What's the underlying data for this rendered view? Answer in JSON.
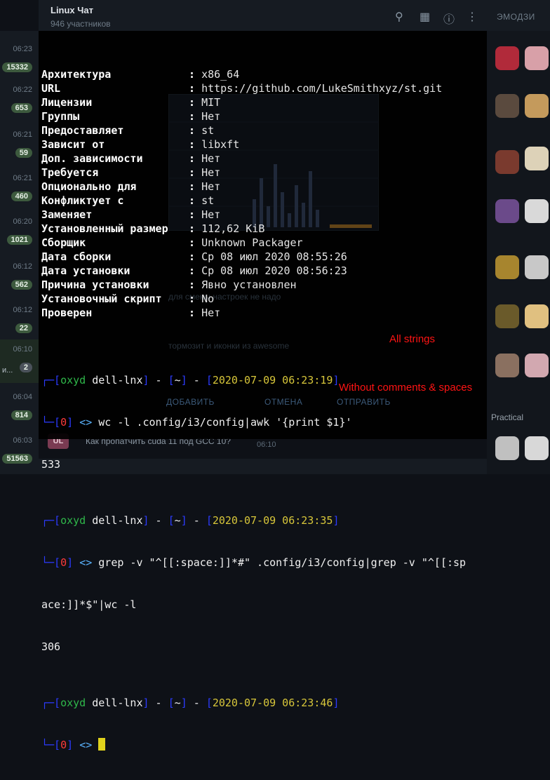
{
  "app": {
    "title": "Linux Чат",
    "subtitle": "946 участников",
    "emoji_tab": "ЭМОДЗИ"
  },
  "chats": [
    {
      "time": "06:23",
      "badge": "15332"
    },
    {
      "time": "06:22",
      "badge": "653"
    },
    {
      "time": "06:21",
      "badge": "59"
    },
    {
      "time": "06:21",
      "badge": "460"
    },
    {
      "time": "06:20",
      "badge": "1021"
    },
    {
      "time": "06:12",
      "badge": "562"
    },
    {
      "time": "06:12",
      "badge": "22"
    },
    {
      "time": "06:10",
      "badge": "2",
      "fragment": "и..."
    },
    {
      "time": "06:04",
      "badge": "814"
    },
    {
      "time": "06:03",
      "badge": "51563"
    }
  ],
  "background_chat": {
    "avatar": "UL",
    "message": "Как пропатчить cuda 11 под GCC 10?",
    "message_time": "06:10",
    "ghost_1": "для смены настроек не надо",
    "ghost_2": "тормозит и иконки из awesome",
    "btn_add": "ДОБАВИТЬ",
    "btn_cancel": "ОТМЕНА",
    "btn_send": "ОТПРАВИТЬ",
    "sticker_label": "Practical"
  },
  "terminal": {
    "package_info": [
      {
        "key": "Архитектура",
        "value": "x86_64"
      },
      {
        "key": "URL",
        "value": "https://github.com/LukeSmithxyz/st.git"
      },
      {
        "key": "Лицензии",
        "value": "MIT"
      },
      {
        "key": "Группы",
        "value": "Нет"
      },
      {
        "key": "Предоставляет",
        "value": "st"
      },
      {
        "key": "Зависит от",
        "value": "libxft"
      },
      {
        "key": "Доп. зависимости",
        "value": "Нет"
      },
      {
        "key": "Требуется",
        "value": "Нет"
      },
      {
        "key": "Опционально для",
        "value": "Нет"
      },
      {
        "key": "Конфликтует с",
        "value": "st"
      },
      {
        "key": "Заменяет",
        "value": "Нет"
      },
      {
        "key": "Установленный размер",
        "value": "112,62 KiB"
      },
      {
        "key": "Сборщик",
        "value": "Unknown Packager"
      },
      {
        "key": "Дата сборки",
        "value": "Ср 08 июл 2020 08:55:26"
      },
      {
        "key": "Дата установки",
        "value": "Ср 08 июл 2020 08:56:23"
      },
      {
        "key": "Причина установки",
        "value": "Явно установлен"
      },
      {
        "key": "Установочный скрипт",
        "value": "No"
      },
      {
        "key": "Проверен",
        "value": "Нет"
      }
    ],
    "user": "oxyd",
    "host": "dell-lnx",
    "cwd": "~",
    "exit_code": "0",
    "prompt_arrow": "<>",
    "sessions": [
      {
        "timestamp": "2020-07-09 06:23:19",
        "command": "wc -l .config/i3/config|awk '{print $1}'",
        "output": "533"
      },
      {
        "timestamp": "2020-07-09 06:23:35",
        "command": "grep -v \"^[[:space:]]*#\" .config/i3/config|grep -v \"^[[:sp",
        "command_cont": "ace:]]*$\"|wc -l",
        "output": "306"
      },
      {
        "timestamp": "2020-07-09 06:23:46"
      }
    ]
  },
  "annotations": {
    "all_strings": "All strings",
    "without_comments": "Without comments & spaces"
  },
  "colors": {
    "prompt_blue": "#2c3bff",
    "prompt_green": "#2fb84a",
    "prompt_red": "#ff3a3a",
    "cursor": "#e0d21c",
    "annotation": "#ff1414"
  }
}
